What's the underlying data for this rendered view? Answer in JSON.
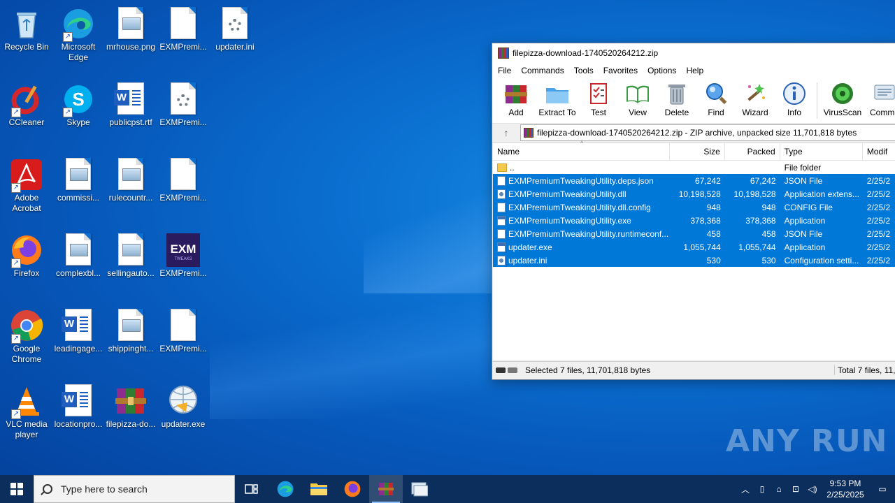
{
  "desktop": {
    "icons": [
      {
        "label": "Recycle Bin"
      },
      {
        "label": "Microsoft Edge"
      },
      {
        "label": "mrhouse.png"
      },
      {
        "label": "EXMPremi..."
      },
      {
        "label": "updater.ini"
      },
      {
        "label": "CCleaner"
      },
      {
        "label": "Skype"
      },
      {
        "label": "publicpst.rtf"
      },
      {
        "label": "EXMPremi..."
      },
      {
        "label": "Adobe Acrobat"
      },
      {
        "label": "commissi..."
      },
      {
        "label": "rulecountr..."
      },
      {
        "label": "EXMPremi..."
      },
      {
        "label": "Firefox"
      },
      {
        "label": "complexbl..."
      },
      {
        "label": "sellingauto..."
      },
      {
        "label": "EXMPremi..."
      },
      {
        "label": "Google Chrome"
      },
      {
        "label": "leadingage..."
      },
      {
        "label": "shippinght..."
      },
      {
        "label": "EXMPremi..."
      },
      {
        "label": "VLC media player"
      },
      {
        "label": "locationpro..."
      },
      {
        "label": "filepizza-do..."
      },
      {
        "label": "updater.exe"
      }
    ]
  },
  "winrar": {
    "title": "filepizza-download-1740520264212.zip",
    "menu": [
      "File",
      "Commands",
      "Tools",
      "Favorites",
      "Options",
      "Help"
    ],
    "toolbar": [
      "Add",
      "Extract To",
      "Test",
      "View",
      "Delete",
      "Find",
      "Wizard",
      "Info",
      "VirusScan",
      "Comme"
    ],
    "path": "filepizza-download-1740520264212.zip - ZIP archive, unpacked size 11,701,818 bytes",
    "columns": {
      "name": "Name",
      "size": "Size",
      "packed": "Packed",
      "type": "Type",
      "modified": "Modif"
    },
    "rows": [
      {
        "name": "..",
        "size": "",
        "packed": "",
        "type": "File folder",
        "modified": "",
        "selected": false,
        "icon": "folder"
      },
      {
        "name": "EXMPremiumTweakingUtility.deps.json",
        "size": "67,242",
        "packed": "67,242",
        "type": "JSON File",
        "modified": "2/25/2",
        "selected": true,
        "icon": "file"
      },
      {
        "name": "EXMPremiumTweakingUtility.dll",
        "size": "10,198,528",
        "packed": "10,198,528",
        "type": "Application extens...",
        "modified": "2/25/2",
        "selected": true,
        "icon": "gear"
      },
      {
        "name": "EXMPremiumTweakingUtility.dll.config",
        "size": "948",
        "packed": "948",
        "type": "CONFIG File",
        "modified": "2/25/2",
        "selected": true,
        "icon": "file"
      },
      {
        "name": "EXMPremiumTweakingUtility.exe",
        "size": "378,368",
        "packed": "378,368",
        "type": "Application",
        "modified": "2/25/2",
        "selected": true,
        "icon": "exe"
      },
      {
        "name": "EXMPremiumTweakingUtility.runtimeconf...",
        "size": "458",
        "packed": "458",
        "type": "JSON File",
        "modified": "2/25/2",
        "selected": true,
        "icon": "file"
      },
      {
        "name": "updater.exe",
        "size": "1,055,744",
        "packed": "1,055,744",
        "type": "Application",
        "modified": "2/25/2",
        "selected": true,
        "icon": "exe"
      },
      {
        "name": "updater.ini",
        "size": "530",
        "packed": "530",
        "type": "Configuration setti...",
        "modified": "2/25/2",
        "selected": true,
        "icon": "gear"
      }
    ],
    "status_left": "Selected 7 files, 11,701,818 bytes",
    "status_right": "Total 7 files, 11,"
  },
  "taskbar": {
    "search_placeholder": "Type here to search",
    "time": "9:53 PM",
    "date": "2/25/2025"
  },
  "watermark": "ANY RUN"
}
